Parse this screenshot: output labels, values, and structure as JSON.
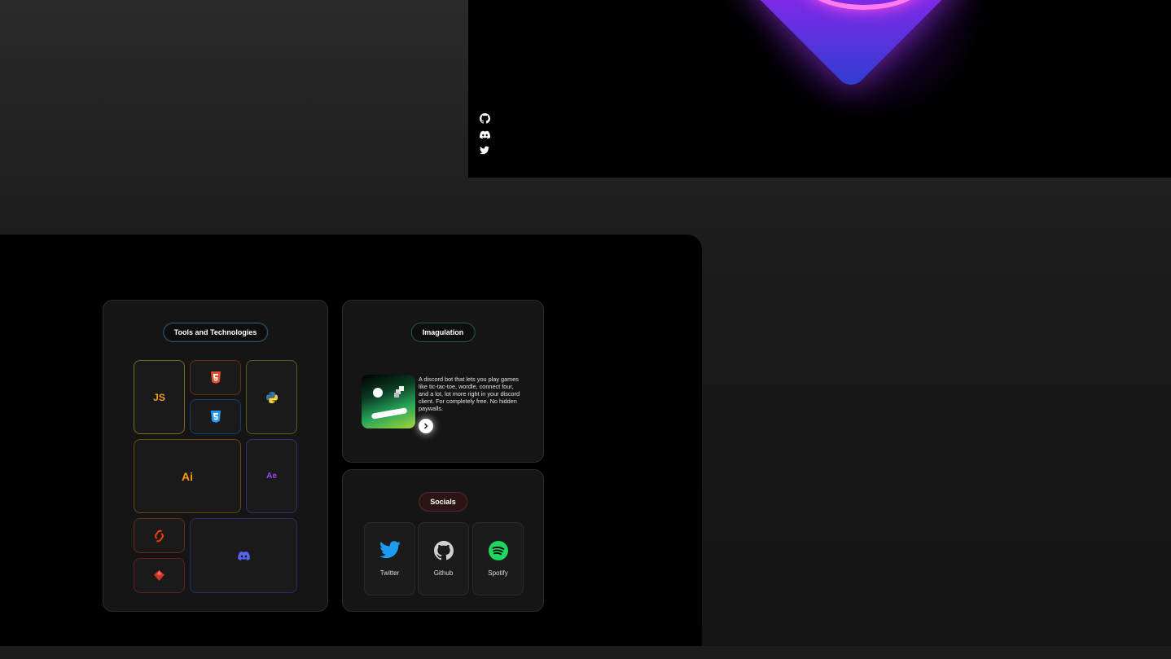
{
  "hero": {
    "social_icons": [
      "github-icon",
      "discord-icon",
      "twitter-icon"
    ]
  },
  "tools": {
    "title": "Tools and Technologies",
    "tiles": [
      {
        "name": "javascript",
        "label": "JS",
        "color": "#f7b21c"
      },
      {
        "name": "html5",
        "color": "#e44d26"
      },
      {
        "name": "css3",
        "color": "#2196f3"
      },
      {
        "name": "python",
        "color": "#3776ab"
      },
      {
        "name": "illustrator",
        "label": "Ai",
        "color": "#ff9a00"
      },
      {
        "name": "after-effects",
        "label": "Ae",
        "color": "#9a47ff"
      },
      {
        "name": "svelte",
        "color": "#ff3e00"
      },
      {
        "name": "ruby",
        "color": "#cc342d"
      },
      {
        "name": "discord",
        "color": "#5865f2"
      }
    ]
  },
  "project": {
    "title": "Imagulation",
    "description": "A discord bot that lets you play games like tic-tac-toe, wordle, connect four, and a lot, lot more right in your discord client. For completely free. No hidden paywalls."
  },
  "socials": {
    "title": "Socials",
    "items": [
      {
        "label": "Twitter",
        "icon": "twitter-icon",
        "color": "#1d9bf0"
      },
      {
        "label": "Github",
        "icon": "github-icon",
        "color": "#dddddd"
      },
      {
        "label": "Spotify",
        "icon": "spotify-icon",
        "color": "#1ed760"
      }
    ]
  }
}
